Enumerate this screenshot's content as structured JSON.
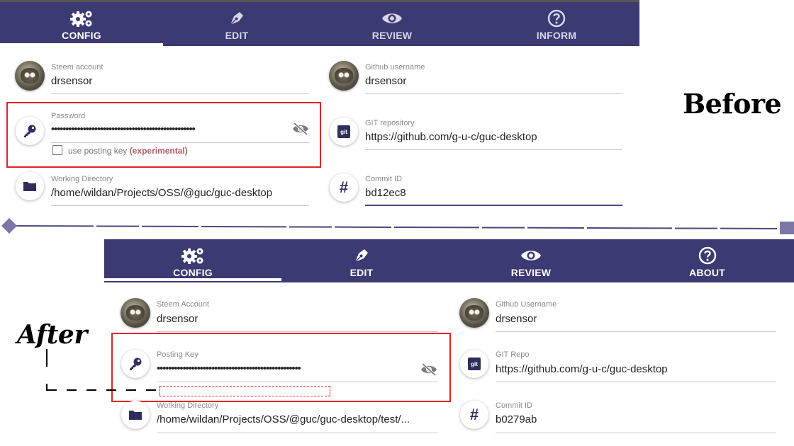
{
  "colors": {
    "nav_bg": "#3b3a73",
    "highlight": "#e02424",
    "accent": "#4a4780"
  },
  "annotations": {
    "before": "Before",
    "after": "After"
  },
  "before": {
    "tabs": [
      {
        "label": "CONFIG",
        "icon": "gears-icon"
      },
      {
        "label": "EDIT",
        "icon": "pen-icon"
      },
      {
        "label": "REVIEW",
        "icon": "eye-icon"
      },
      {
        "label": "INFORM",
        "icon": "help-icon"
      }
    ],
    "steem_account": {
      "label": "Steem account",
      "value": "drsensor"
    },
    "password": {
      "label": "Password",
      "value": "••••••••••••••••••••••••••••••••••••••••••••••••••"
    },
    "posting_key_checkbox": {
      "label": "use posting key",
      "note": "(experimental)"
    },
    "working_directory": {
      "label": "Working Directory",
      "value": "/home/wildan/Projects/OSS/@guc/guc-desktop"
    },
    "github_username": {
      "label": "Github username",
      "value": "drsensor"
    },
    "git_repository": {
      "label": "GIT repository",
      "value": "https://github.com/g-u-c/guc-desktop"
    },
    "commit_id": {
      "label": "Commit ID",
      "value": "bd12ec8"
    }
  },
  "after": {
    "tabs": [
      {
        "label": "CONFIG",
        "icon": "gears-icon"
      },
      {
        "label": "EDIT",
        "icon": "pen-icon"
      },
      {
        "label": "REVIEW",
        "icon": "eye-icon"
      },
      {
        "label": "ABOUT",
        "icon": "help-icon"
      }
    ],
    "steem_account": {
      "label": "Steem Account",
      "value": "drsensor"
    },
    "posting_key": {
      "label": "Posting Key",
      "value": "••••••••••••••••••••••••••••••••••••••••••••••••••"
    },
    "working_directory": {
      "label": "Working Directory",
      "value": "/home/wildan/Projects/OSS/@guc/guc-desktop/test/..."
    },
    "github_username": {
      "label": "Github Username",
      "value": "drsensor"
    },
    "git_repo": {
      "label": "GIT Repo",
      "value": "https://github.com/g-u-c/guc-desktop"
    },
    "commit_id": {
      "label": "Commit ID",
      "value": "b0279ab"
    }
  }
}
